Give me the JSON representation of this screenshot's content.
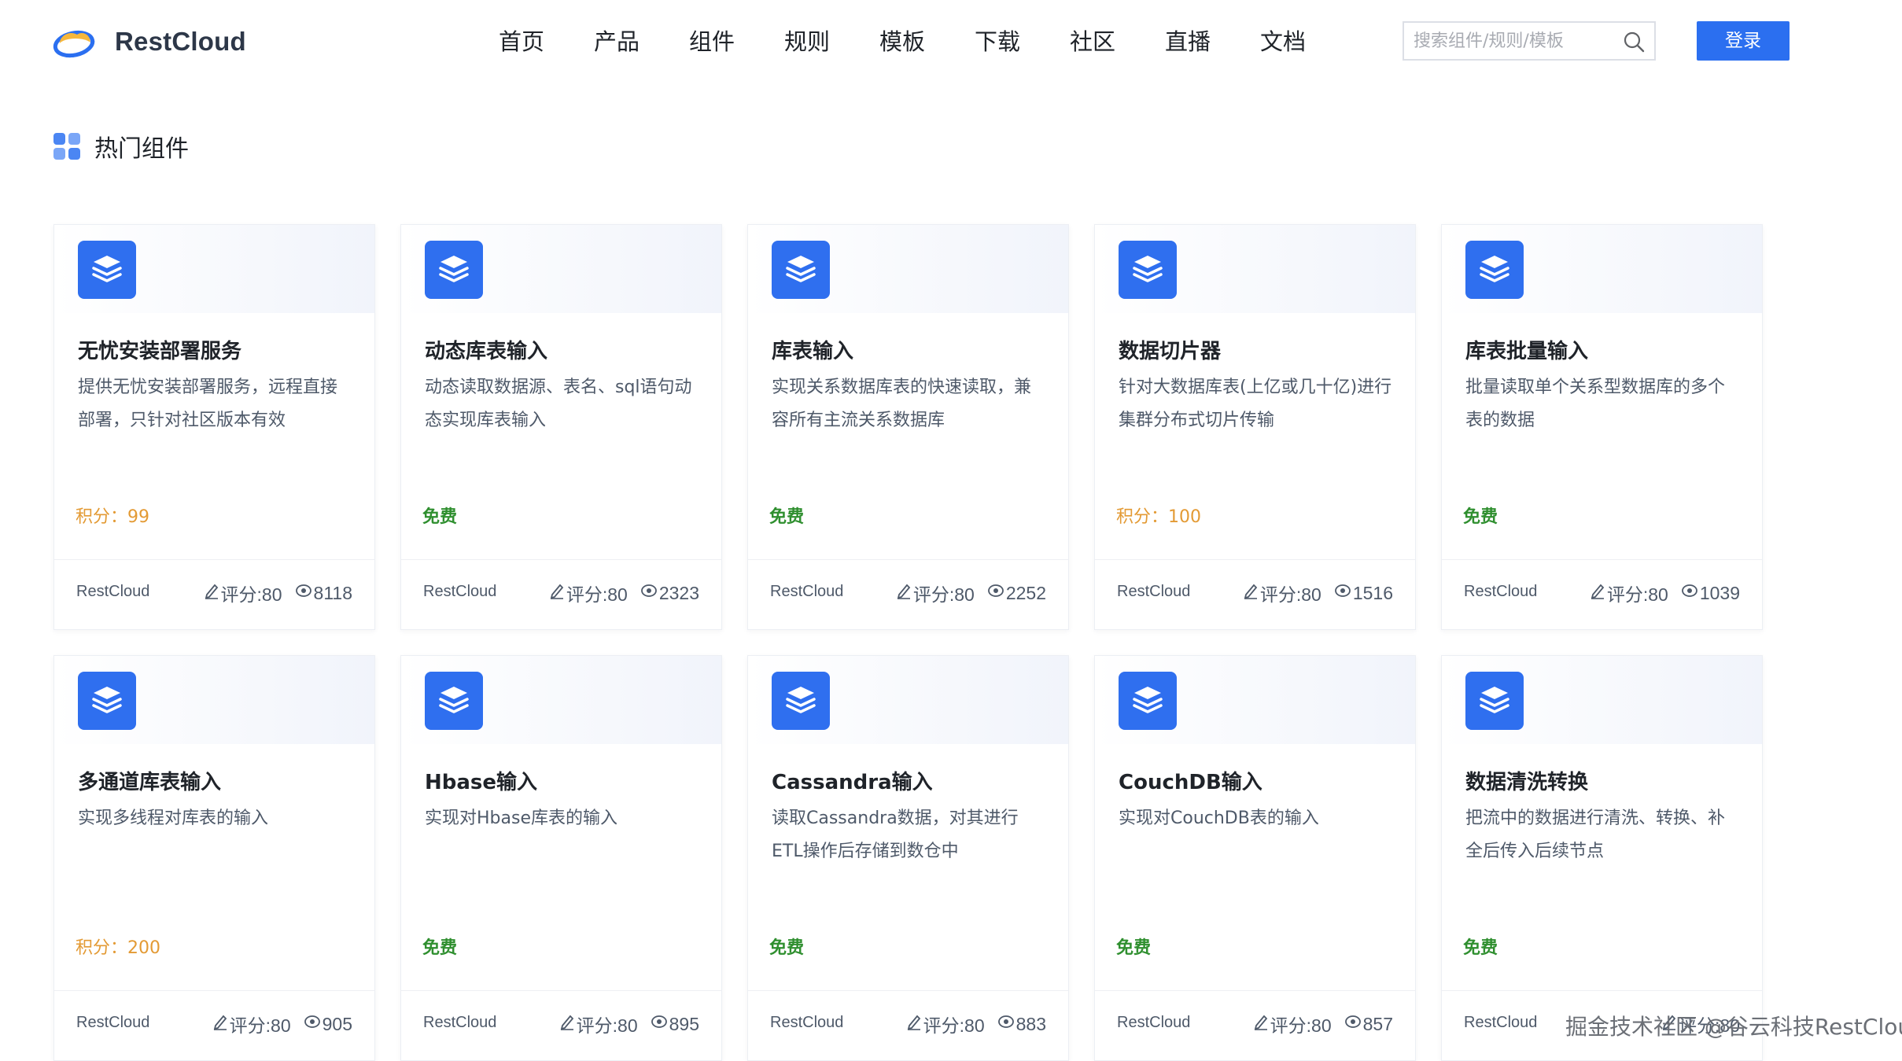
{
  "brand": {
    "name": "RestCloud",
    "accent": "#2b6ff0",
    "points_color": "#e39a34",
    "free_color": "#2f8f2f"
  },
  "nav": [
    "首页",
    "产品",
    "组件",
    "规则",
    "模板",
    "下载",
    "社区",
    "直播",
    "文档"
  ],
  "search": {
    "placeholder": "搜索组件/规则/模板",
    "icon": "search-icon"
  },
  "login_label": "登录",
  "section": {
    "title": "热门组件",
    "icon": "grid-icon"
  },
  "cards": [
    {
      "title": "无忧安装部署服务",
      "desc": "提供无忧安装部署服务，远程直接部署，只针对社区版本有效",
      "price": "积分：99",
      "price_type": "points",
      "author": "RestCloud",
      "rating": "评分:80",
      "views": "8118"
    },
    {
      "title": "动态库表输入",
      "desc": "动态读取数据源、表名、sql语句动态实现库表输入",
      "price": "免费",
      "price_type": "free",
      "author": "RestCloud",
      "rating": "评分:80",
      "views": "2323"
    },
    {
      "title": "库表输入",
      "desc": "实现关系数据库表的快速读取，兼容所有主流关系数据库",
      "price": "免费",
      "price_type": "free",
      "author": "RestCloud",
      "rating": "评分:80",
      "views": "2252"
    },
    {
      "title": "数据切片器",
      "desc": "针对大数据库表(上亿或几十亿)进行集群分布式切片传输",
      "price": "积分：100",
      "price_type": "points",
      "author": "RestCloud",
      "rating": "评分:80",
      "views": "1516"
    },
    {
      "title": "库表批量输入",
      "desc": "批量读取单个关系型数据库的多个表的数据",
      "price": "免费",
      "price_type": "free",
      "author": "RestCloud",
      "rating": "评分:80",
      "views": "1039"
    },
    {
      "title": "多通道库表输入",
      "desc": "实现多线程对库表的输入",
      "price": "积分：200",
      "price_type": "points",
      "author": "RestCloud",
      "rating": "评分:80",
      "views": "905"
    },
    {
      "title": "Hbase输入",
      "desc": "实现对Hbase库表的输入",
      "price": "免费",
      "price_type": "free",
      "author": "RestCloud",
      "rating": "评分:80",
      "views": "895"
    },
    {
      "title": "Cassandra输入",
      "desc": "读取Cassandra数据，对其进行ETL操作后存储到数仓中",
      "price": "免费",
      "price_type": "free",
      "author": "RestCloud",
      "rating": "评分:80",
      "views": "883"
    },
    {
      "title": "CouchDB输入",
      "desc": "实现对CouchDB表的输入",
      "price": "免费",
      "price_type": "free",
      "author": "RestCloud",
      "rating": "评分:80",
      "views": "857"
    },
    {
      "title": "数据清洗转换",
      "desc": "把流中的数据进行清洗、转换、补全后传入后续节点",
      "price": "免费",
      "price_type": "free",
      "author": "RestCloud",
      "rating": "评分:80",
      "views": ""
    }
  ],
  "watermark": "掘金技术社区 @谷云科技RestCloud"
}
